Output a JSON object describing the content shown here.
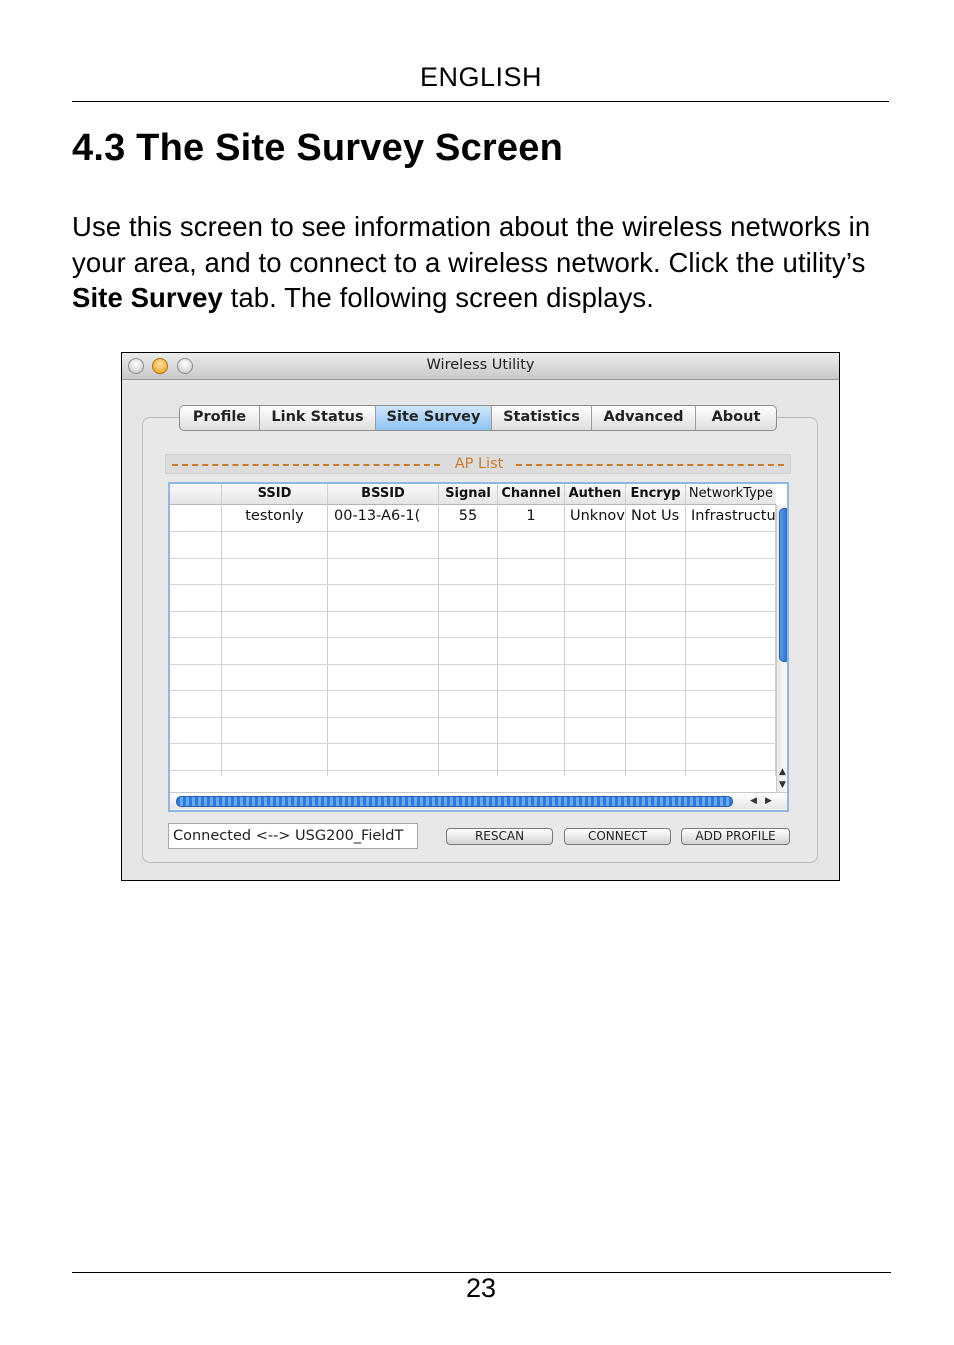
{
  "page": {
    "language": "ENGLISH",
    "section_title": "4.3 The Site Survey Screen",
    "intro": {
      "part1": "Use this screen to see information about the wireless networks in your area, and to connect to a wireless network. Click the utility’s ",
      "bold": "Site Survey",
      "part2": " tab. The following screen displays."
    },
    "page_number": "23"
  },
  "window": {
    "title": "Wireless Utility",
    "tabs": [
      "Profile",
      "Link Status",
      "Site Survey",
      "Statistics",
      "Advanced",
      "About"
    ],
    "active_tab": "Site Survey",
    "ap_list_label": "AP List",
    "table": {
      "headers": [
        "",
        "SSID",
        "BSSID",
        "Signal",
        "Channel",
        "Authen",
        "Encryp",
        "NetworkType"
      ],
      "rows": [
        [
          "",
          "testonly",
          "00-13-A6-1(",
          "55",
          "1",
          "Unknov",
          "Not Us",
          "Infrastructu"
        ]
      ]
    },
    "status_text": "Connected <--> USG200_FieldT",
    "buttons": {
      "rescan": "RESCAN",
      "connect": "CONNECT",
      "add_profile": "ADD PROFILE"
    },
    "colors": {
      "active_tab": "#8ec3f2",
      "ap_list_accent": "#c77b2f",
      "table_border": "#8fb7e2",
      "scroll_thumb": "#1e64c8"
    }
  }
}
